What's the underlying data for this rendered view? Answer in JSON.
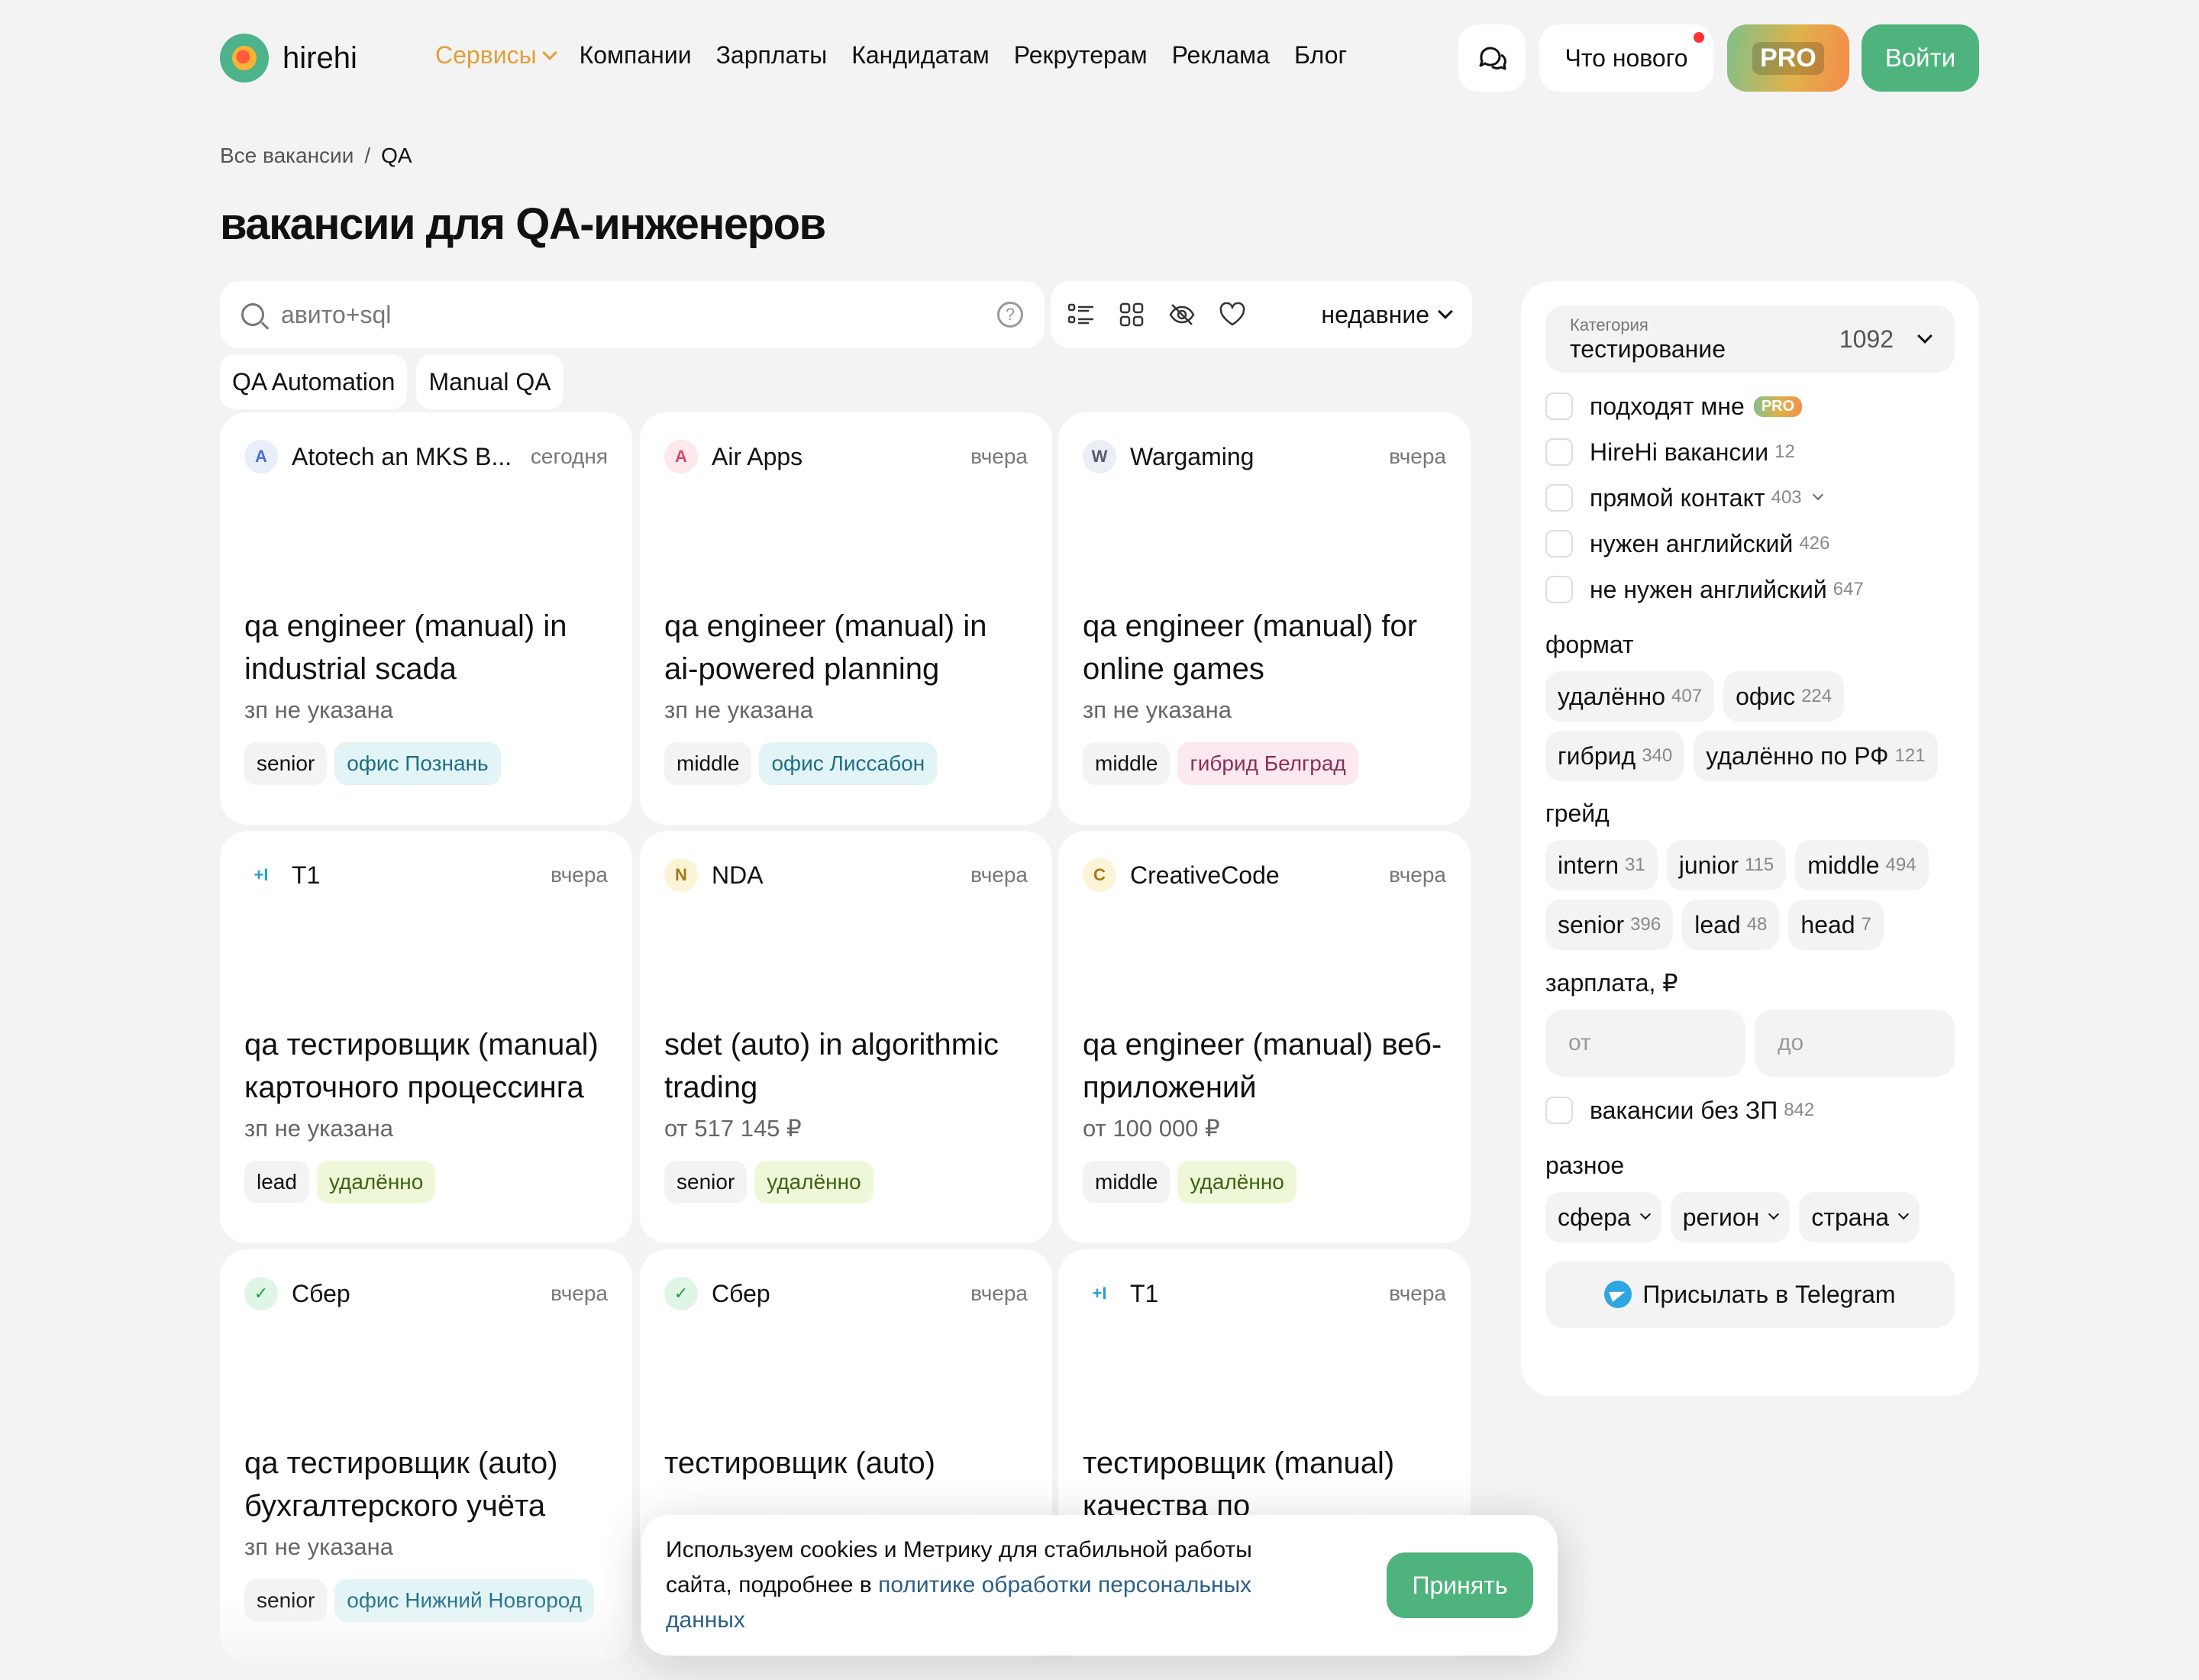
{
  "header": {
    "logo_text": "hirehi",
    "nav": [
      "Компании",
      "Зарплаты",
      "Кандидатам",
      "Рекрутерам",
      "Реклама",
      "Блог"
    ],
    "nav_active": "Сервисы",
    "whats_new": "Что нового",
    "pro": "PRO",
    "login": "Войти"
  },
  "breadcrumb": {
    "root": "Все вакансии",
    "sep": "/",
    "current": "QA"
  },
  "title": "вакансии для QA-инженеров",
  "search": {
    "value": "авито+sql",
    "help": "?"
  },
  "sort": "недавние",
  "quick_tags": [
    "QA Automation",
    "Manual QA"
  ],
  "cards": [
    {
      "letter": "A",
      "avatar_bg": "#e8eefc",
      "avatar_fg": "#4a6fd1",
      "company": "Atotech an MKS B...",
      "date": "сегодня",
      "title": "qa engineer (manual) in industrial scada",
      "salary": "зп не указана",
      "grade": "senior",
      "place": "офис Познань",
      "place_kind": "blue"
    },
    {
      "letter": "A",
      "avatar_bg": "#fde8ec",
      "avatar_fg": "#d14a6a",
      "company": "Air Apps",
      "date": "вчера",
      "title": "qa engineer (manual) in ai-powered planning",
      "salary": "зп не указана",
      "grade": "middle",
      "place": "офис Лиссабон",
      "place_kind": "blue"
    },
    {
      "letter": "W",
      "avatar_bg": "#eceef5",
      "avatar_fg": "#555a75",
      "company": "Wargaming",
      "date": "вчера",
      "title": "qa engineer (manual) for online games",
      "salary": "зп не указана",
      "grade": "middle",
      "place": "гибрид Белград",
      "place_kind": "pink"
    },
    {
      "letter": "+I",
      "avatar_bg": "#ffffff",
      "avatar_fg": "#1fa3d8",
      "company": "T1",
      "date": "вчера",
      "title": "qa тестировщик (manual) карточного процессинга",
      "salary": "зп не указана",
      "grade": "lead",
      "place": "удалённо",
      "place_kind": "green"
    },
    {
      "letter": "N",
      "avatar_bg": "#fdf3d6",
      "avatar_fg": "#a07a18",
      "company": "NDA",
      "date": "вчера",
      "title": "sdet (auto) in algorithmic trading",
      "salary": "от 517 145 ₽",
      "grade": "senior",
      "place": "удалённо",
      "place_kind": "green"
    },
    {
      "letter": "C",
      "avatar_bg": "#fdf3d6",
      "avatar_fg": "#a07a18",
      "company": "CreativeCode",
      "date": "вчера",
      "title": "qa engineer (manual) веб-приложений",
      "salary": "от 100 000 ₽",
      "grade": "middle",
      "place": "удалённо",
      "place_kind": "green"
    },
    {
      "letter": "✓",
      "avatar_bg": "#dff5e6",
      "avatar_fg": "#21a038",
      "company": "Сбер",
      "date": "вчера",
      "title": "qa тестировщик (auto) бухгалтерского учёта",
      "salary": "зп не указана",
      "grade": "senior",
      "place": "офис Нижний Новгород",
      "place_kind": "blue"
    },
    {
      "letter": "✓",
      "avatar_bg": "#dff5e6",
      "avatar_fg": "#21a038",
      "company": "Сбер",
      "date": "вчера",
      "title": "тестировщик (auto)",
      "salary": "",
      "grade": "",
      "place": "",
      "place_kind": "blue"
    },
    {
      "letter": "+I",
      "avatar_bg": "#ffffff",
      "avatar_fg": "#1fa3d8",
      "company": "T1",
      "date": "вчера",
      "title": "тестировщик (manual) качества по",
      "salary": "",
      "grade": "",
      "place": "",
      "place_kind": "blue"
    }
  ],
  "sidebar": {
    "category_label": "Категория",
    "category_value": "тестирование",
    "category_count": "1092",
    "checks": [
      {
        "label": "подходят мне",
        "count": "",
        "pro": "PRO"
      },
      {
        "label": "HireHi вакансии",
        "count": "12"
      },
      {
        "label": "прямой контакт",
        "count": "403"
      },
      {
        "label": "нужен английский",
        "count": "426"
      },
      {
        "label": "не нужен английский",
        "count": "647"
      }
    ],
    "format_title": "формат",
    "format": [
      {
        "label": "удалённо",
        "count": "407"
      },
      {
        "label": "офис",
        "count": "224"
      },
      {
        "label": "гибрид",
        "count": "340"
      },
      {
        "label": "удалённо по РФ",
        "count": "121"
      }
    ],
    "grade_title": "грейд",
    "grades": [
      {
        "label": "intern",
        "count": "31"
      },
      {
        "label": "junior",
        "count": "115"
      },
      {
        "label": "middle",
        "count": "494"
      },
      {
        "label": "senior",
        "count": "396"
      },
      {
        "label": "lead",
        "count": "48"
      },
      {
        "label": "head",
        "count": "7"
      }
    ],
    "salary_title": "зарплата, ₽",
    "salary_from": "от",
    "salary_to": "до",
    "no_salary_label": "вакансии без ЗП",
    "no_salary_count": "842",
    "misc_title": "разное",
    "misc": [
      "сфера",
      "регион",
      "страна"
    ],
    "telegram": "Присылать в Telegram"
  },
  "cookie": {
    "text_before": "Используем cookies и Метрику для стабильной работы сайта, подробнее в ",
    "link": "политике обработки персональных данных",
    "accept": "Принять"
  }
}
